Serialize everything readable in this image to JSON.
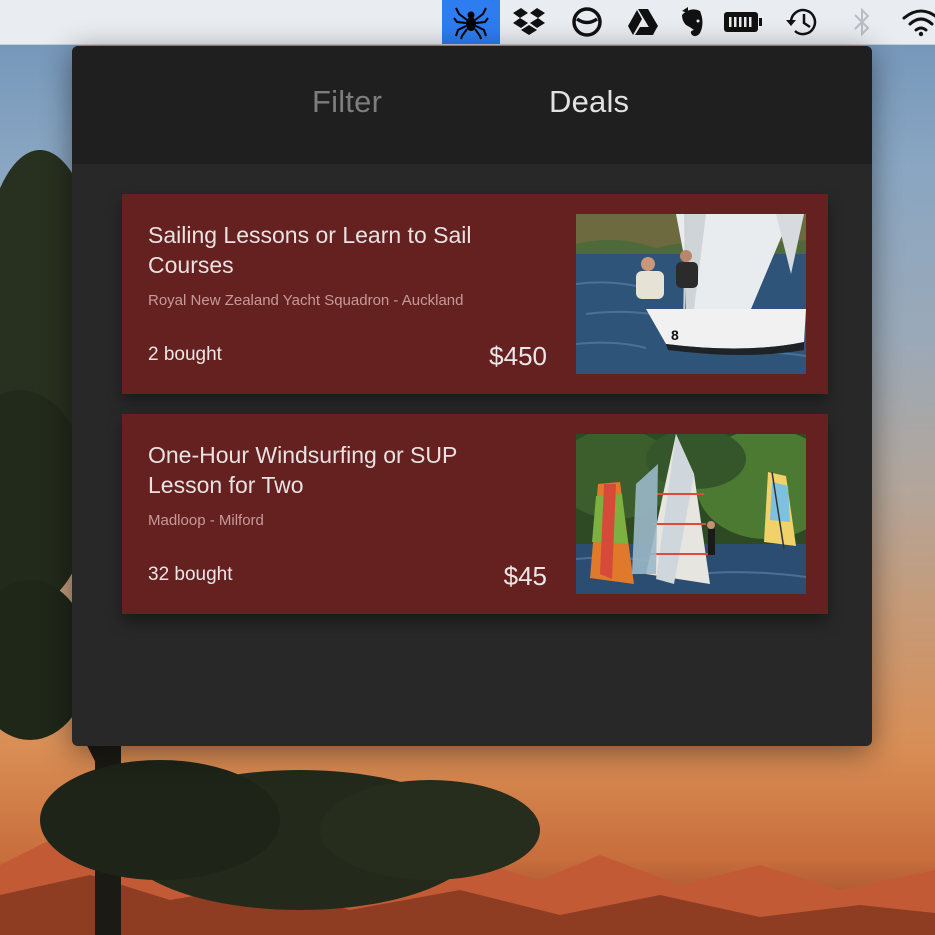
{
  "menubar": {
    "icons": [
      {
        "name": "spider-icon",
        "active": true
      },
      {
        "name": "dropbox-icon"
      },
      {
        "name": "circle-slash-icon"
      },
      {
        "name": "google-drive-icon"
      },
      {
        "name": "evernote-icon"
      },
      {
        "name": "battery-icon"
      },
      {
        "name": "time-machine-icon"
      },
      {
        "name": "bluetooth-icon"
      },
      {
        "name": "wifi-icon"
      }
    ]
  },
  "popover": {
    "tabs": {
      "filter": "Filter",
      "deals": "Deals"
    },
    "active_tab": "Deals",
    "deals": [
      {
        "title": "Sailing Lessons or Learn to Sail Courses",
        "merchant": "Royal New Zealand Yacht Squadron - Auckland",
        "bought": "2 bought",
        "price": "$450",
        "image": "sailing-photo"
      },
      {
        "title": "One-Hour Windsurfing or SUP Lesson for Two",
        "merchant": "Madloop - Milford",
        "bought": "32 bought",
        "price": "$45",
        "image": "windsurfing-photo"
      }
    ]
  },
  "colors": {
    "menubar_active": "#2d7cf0",
    "popover_bg": "#282828",
    "header_bg": "#1f1f1f",
    "card_bg": "#642120"
  }
}
